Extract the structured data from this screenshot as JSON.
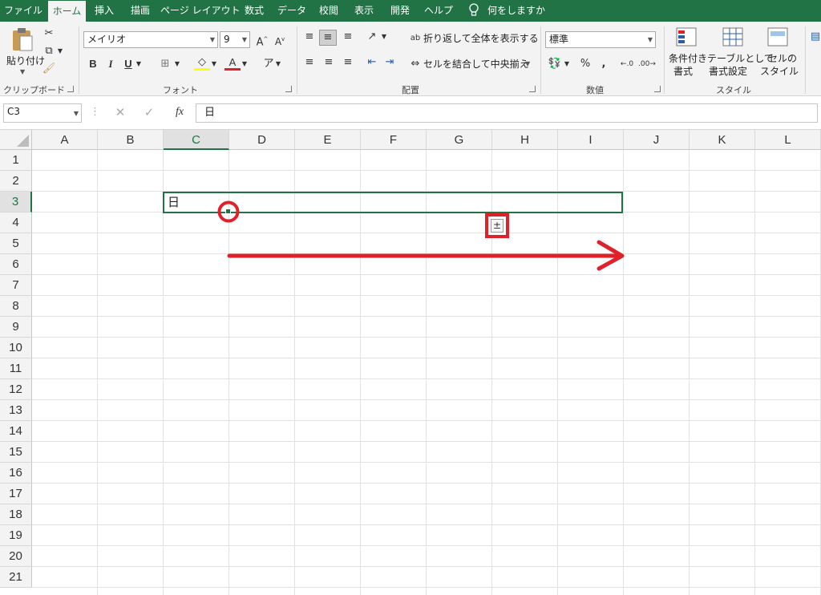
{
  "tabs": [
    {
      "label": "ファイル",
      "active": false
    },
    {
      "label": "ホーム",
      "active": true
    },
    {
      "label": "挿入",
      "active": false
    },
    {
      "label": "描画",
      "active": false
    },
    {
      "label": "ページ レイアウト",
      "active": false
    },
    {
      "label": "数式",
      "active": false
    },
    {
      "label": "データ",
      "active": false
    },
    {
      "label": "校閲",
      "active": false
    },
    {
      "label": "表示",
      "active": false
    },
    {
      "label": "開発",
      "active": false
    },
    {
      "label": "ヘルプ",
      "active": false
    }
  ],
  "tell_me": "何をしますか",
  "clipboard": {
    "paste": "貼り付け",
    "group": "クリップボード"
  },
  "font": {
    "name": "メイリオ",
    "size": "9",
    "group": "フォント",
    "bold": "B",
    "italic": "I",
    "underline": "U"
  },
  "alignment": {
    "wrap": "折り返して全体を表示する",
    "merge": "セルを結合して中央揃え",
    "group": "配置"
  },
  "number": {
    "format": "標準",
    "percent": "%",
    "comma": ",",
    "group": "数値"
  },
  "styles": {
    "conditional": "条件付き",
    "conditional2": "書式",
    "table": "テーブルとして",
    "table2": "書式設定",
    "cell": "セルの",
    "cell2": "スタイル",
    "group": "スタイル"
  },
  "formula_bar": {
    "name_box": "C3",
    "fx": "fx",
    "content": "日"
  },
  "columns": [
    "A",
    "B",
    "C",
    "D",
    "E",
    "F",
    "G",
    "H",
    "I",
    "J",
    "K",
    "L"
  ],
  "rows": [
    "1",
    "2",
    "3",
    "4",
    "5",
    "6",
    "7",
    "8",
    "9",
    "10",
    "11",
    "12",
    "13",
    "14",
    "15",
    "16",
    "17",
    "18",
    "19",
    "20",
    "21"
  ],
  "selected_cell": "C3",
  "cell_value": "日",
  "autofill_icon": "±",
  "colors": {
    "excel_green": "#217346",
    "annotation_red": "#e0202a"
  }
}
